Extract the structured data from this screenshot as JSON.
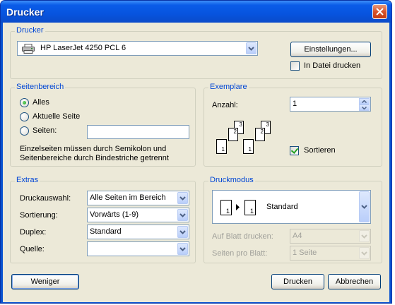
{
  "window": {
    "title": "Drucker"
  },
  "drucker_group": {
    "legend": "Drucker",
    "printer_name": "HP LaserJet 4250 PCL 6",
    "settings_button": "Einstellungen...",
    "print_to_file_label": "In Datei drucken",
    "print_to_file_checked": false
  },
  "seitenbereich": {
    "legend": "Seitenbereich",
    "options": [
      "Alles",
      "Aktuelle Seite",
      "Seiten:"
    ],
    "selected": "Alles",
    "pages_value": "",
    "hint_line1": "Einzelseiten müssen durch Semikolon und",
    "hint_line2": "Seitenbereiche durch Bindestriche getrennt"
  },
  "exemplare": {
    "legend": "Exemplare",
    "count_label": "Anzahl:",
    "count_value": "1",
    "collate_label": "Sortieren",
    "collate_checked": true,
    "page_numbers": [
      "1",
      "2",
      "3",
      "1",
      "2",
      "3"
    ]
  },
  "extras": {
    "legend": "Extras",
    "rows": [
      {
        "label": "Druckauswahl:",
        "value": "Alle Seiten im Bereich"
      },
      {
        "label": "Sortierung:",
        "value": "Vorwärts (1-9)"
      },
      {
        "label": "Duplex:",
        "value": "Standard"
      },
      {
        "label": "Quelle:",
        "value": ""
      }
    ]
  },
  "druckmodus": {
    "legend": "Druckmodus",
    "mode_value": "Standard",
    "mode_pages": [
      "1",
      "1"
    ],
    "sheet_label": "Auf Blatt drucken:",
    "sheet_value": "A4",
    "pages_per_sheet_label": "Seiten pro Blatt:",
    "pages_per_sheet_value": "1 Seite"
  },
  "footer": {
    "less_button": "Weniger",
    "print_button": "Drucken",
    "cancel_button": "Abbrechen"
  }
}
